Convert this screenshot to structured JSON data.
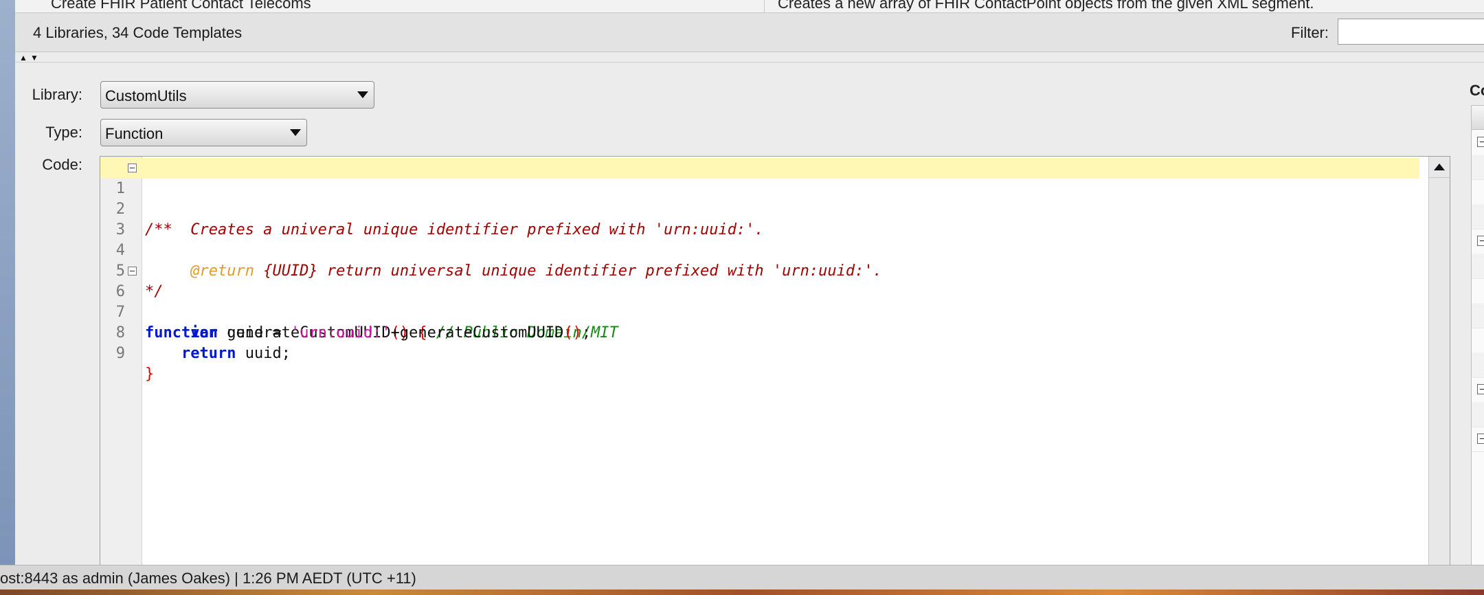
{
  "top_row": {
    "name_cell": "Create FHIR Patient Contact Telecoms",
    "description_cell": "Creates a new array of FHIR ContactPoint objects from the given XML segment."
  },
  "summary": {
    "count_text": "4 Libraries, 34 Code Templates",
    "filter_label": "Filter:",
    "filter_value": ""
  },
  "form": {
    "library_label": "Library:",
    "library_value": "CustomUtils",
    "type_label": "Type:",
    "type_value": "Function",
    "code_label": "Code:"
  },
  "code_lines": [
    {
      "n": "1",
      "folded": true,
      "current": true,
      "text": "/**"
    },
    {
      "n": "2",
      "text": "     Creates a univeral unique identifier prefixed with 'urn:uuid:'."
    },
    {
      "n": "3",
      "text": ""
    },
    {
      "n": "4",
      "tag": "     @return",
      "text": " {UUID} return universal unique identifier prefixed with 'urn:uuid:'."
    },
    {
      "n": "5",
      "text": "*/"
    },
    {
      "n": "6",
      "folded": true,
      "kw": "function",
      "name": " generateCustomUUID",
      "paren": "() {",
      "comment": " // Public Domain/MIT"
    },
    {
      "n": "7",
      "indent": "     ",
      "kw": "var",
      "pre": " uuid = ",
      "str": "'urn:uuid:'",
      "post": "+generateCustomUUID",
      "paren": "()",
      "end": ";"
    },
    {
      "n": "8",
      "indent": "    ",
      "kw": "return",
      "post": " uuid;"
    },
    {
      "n": "9",
      "text": "}"
    }
  ],
  "right_panel": {
    "title": "Con"
  },
  "status": {
    "text": "ost:8443 as admin (James Oakes)  |  1:26 PM AEDT (UTC +11)"
  }
}
